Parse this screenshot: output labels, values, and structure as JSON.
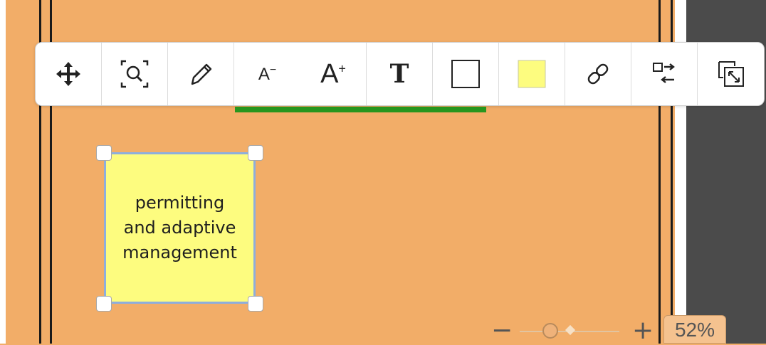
{
  "toolbar": {
    "tools": [
      {
        "name": "move",
        "icon": "move-arrows-icon"
      },
      {
        "name": "zoom-to-fit",
        "icon": "zoom-frame-icon"
      },
      {
        "name": "draw",
        "icon": "pencil-icon"
      },
      {
        "name": "decrease-font",
        "label": "A",
        "sup": "−"
      },
      {
        "name": "increase-font",
        "label": "A",
        "sup": "+"
      },
      {
        "name": "text-style",
        "label": "T"
      },
      {
        "name": "border",
        "icon": "border-square-icon"
      },
      {
        "name": "fill-color",
        "icon": "color-swatch-icon",
        "color": "#fdfc7f"
      },
      {
        "name": "link",
        "icon": "link-icon"
      },
      {
        "name": "swap",
        "icon": "swap-arrows-icon"
      },
      {
        "name": "resize",
        "icon": "resize-icon"
      }
    ]
  },
  "canvas": {
    "background": "#f2ad68",
    "note": {
      "text": "permitting\nand adaptive\nmanagement",
      "fill": "#fdfc7f",
      "border": "#8eaedc"
    }
  },
  "zoom": {
    "minus_label": "−",
    "plus_label": "+",
    "level": "52%"
  },
  "colors": {
    "selection_bar": "#27961e",
    "side_panel": "#4b4b4b"
  }
}
